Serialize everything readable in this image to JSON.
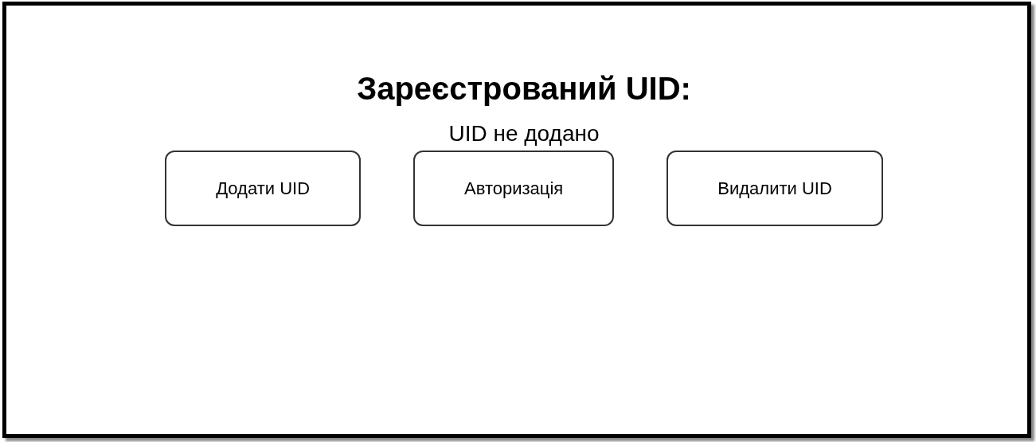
{
  "title": "Зареєстрований UID:",
  "status": "UID не додано",
  "buttons": [
    "Додати UID",
    "Авторизація",
    "Видалити UID"
  ]
}
